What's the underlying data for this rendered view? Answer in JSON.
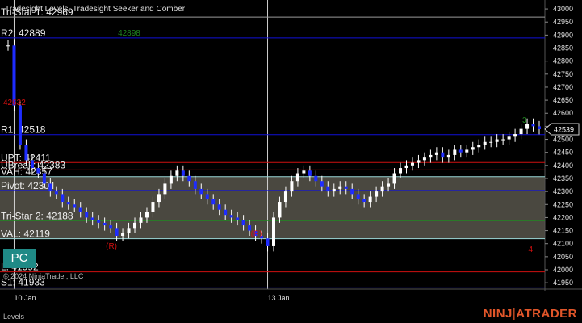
{
  "chart_data": {
    "type": "line",
    "title": "Tradesight Levels, Tradesight Seeker and Comber",
    "panel_label": "Levels",
    "copyright": "© 2024 NinjaTrader, LLC",
    "ylim": [
      41935,
      43025
    ],
    "y_ticks": [
      41950,
      42000,
      42050,
      42100,
      42150,
      42200,
      42250,
      42300,
      42350,
      42400,
      42450,
      42500,
      42550,
      42600,
      42650,
      42700,
      42750,
      42800,
      42850,
      42900,
      42950,
      43000
    ],
    "x_ticks": [
      {
        "label": "10 Jan",
        "bar": 1
      },
      {
        "label": "13 Jan",
        "bar": 43
      }
    ],
    "current_price": 42539,
    "value_area": {
      "low": 42119,
      "high": 42357
    },
    "levels": [
      {
        "name": "Tri-Star 1",
        "value": 42969,
        "label": "Tri-Star 1: 42969",
        "color": "#9a9a9a"
      },
      {
        "name": "R2",
        "value": 42889,
        "label": "R2: 42889",
        "color": "#1010d8"
      },
      {
        "name": "R1",
        "value": 42518,
        "label": "R1: 42518",
        "color": "#1010d8"
      },
      {
        "name": "UPT",
        "value": 42411,
        "label": "UPT: 42411",
        "color": "#d01010"
      },
      {
        "name": "UBreak",
        "value": 42383,
        "label": "UBreak: 42383",
        "color": "#d01010"
      },
      {
        "name": "VAH",
        "value": 42357,
        "label": "VAH: 42357",
        "color": "#9ad8d8"
      },
      {
        "name": "Pivot",
        "value": 42304,
        "label": "Pivot: 42304",
        "color": "#1010d8"
      },
      {
        "name": "Tri-Star 2",
        "value": 42188,
        "label": "Tri-Star 2: 42188",
        "color": "#208820"
      },
      {
        "name": "VAL",
        "value": 42119,
        "label": "VAL: 42119",
        "color": "#9ad8d8"
      },
      {
        "name": "L",
        "value": 41992,
        "label": "L: 41992",
        "color": "#d01010"
      },
      {
        "name": "S1",
        "value": 41933,
        "label": "S1: 41933",
        "color": "#1010d8"
      }
    ],
    "annotations": [
      {
        "text": "42898",
        "color": "#208820",
        "bar": 19,
        "value": 42898
      },
      {
        "text": "42632",
        "color": "#d01010",
        "bar": 0,
        "value": 42632
      },
      {
        "text": "(R)",
        "color": "#d01010",
        "bar": 17,
        "value": 42080
      },
      {
        "text": "4",
        "color": "#d01010",
        "bar": 87,
        "value": 42068
      },
      {
        "text": "(R)",
        "color": "#d01010",
        "bar": 41,
        "value": 42128
      },
      {
        "text": "3",
        "color": "#208820",
        "bar": 86,
        "value": 42564
      }
    ],
    "series": [
      {
        "values": [
          42860,
          42630,
          42480,
          42420,
          42390,
          42370,
          42330,
          42300,
          42290,
          42260,
          42250,
          42240,
          42220,
          42200,
          42190,
          42180,
          42170,
          42160,
          42130,
          42140,
          42160,
          42180,
          42200,
          42220,
          42260,
          42290,
          42330,
          42360,
          42380,
          42360,
          42340,
          42310,
          42290,
          42270,
          42250,
          42230,
          42210,
          42200,
          42190,
          42170,
          42150,
          42130,
          42120,
          42090,
          42200,
          42260,
          42300,
          42340,
          42370,
          42380,
          42360,
          42340,
          42320,
          42300,
          42310,
          42320,
          42310,
          42290,
          42270,
          42260,
          42280,
          42300,
          42320,
          42330,
          42370,
          42390,
          42400,
          42410,
          42420,
          42430,
          42440,
          42450,
          42430,
          42440,
          42460,
          42450,
          42460,
          42470,
          42480,
          42490,
          42490,
          42500,
          42500,
          42510,
          42520,
          42540,
          42560,
          42550,
          42539
        ]
      }
    ]
  },
  "right_label": "NINJATRADER"
}
